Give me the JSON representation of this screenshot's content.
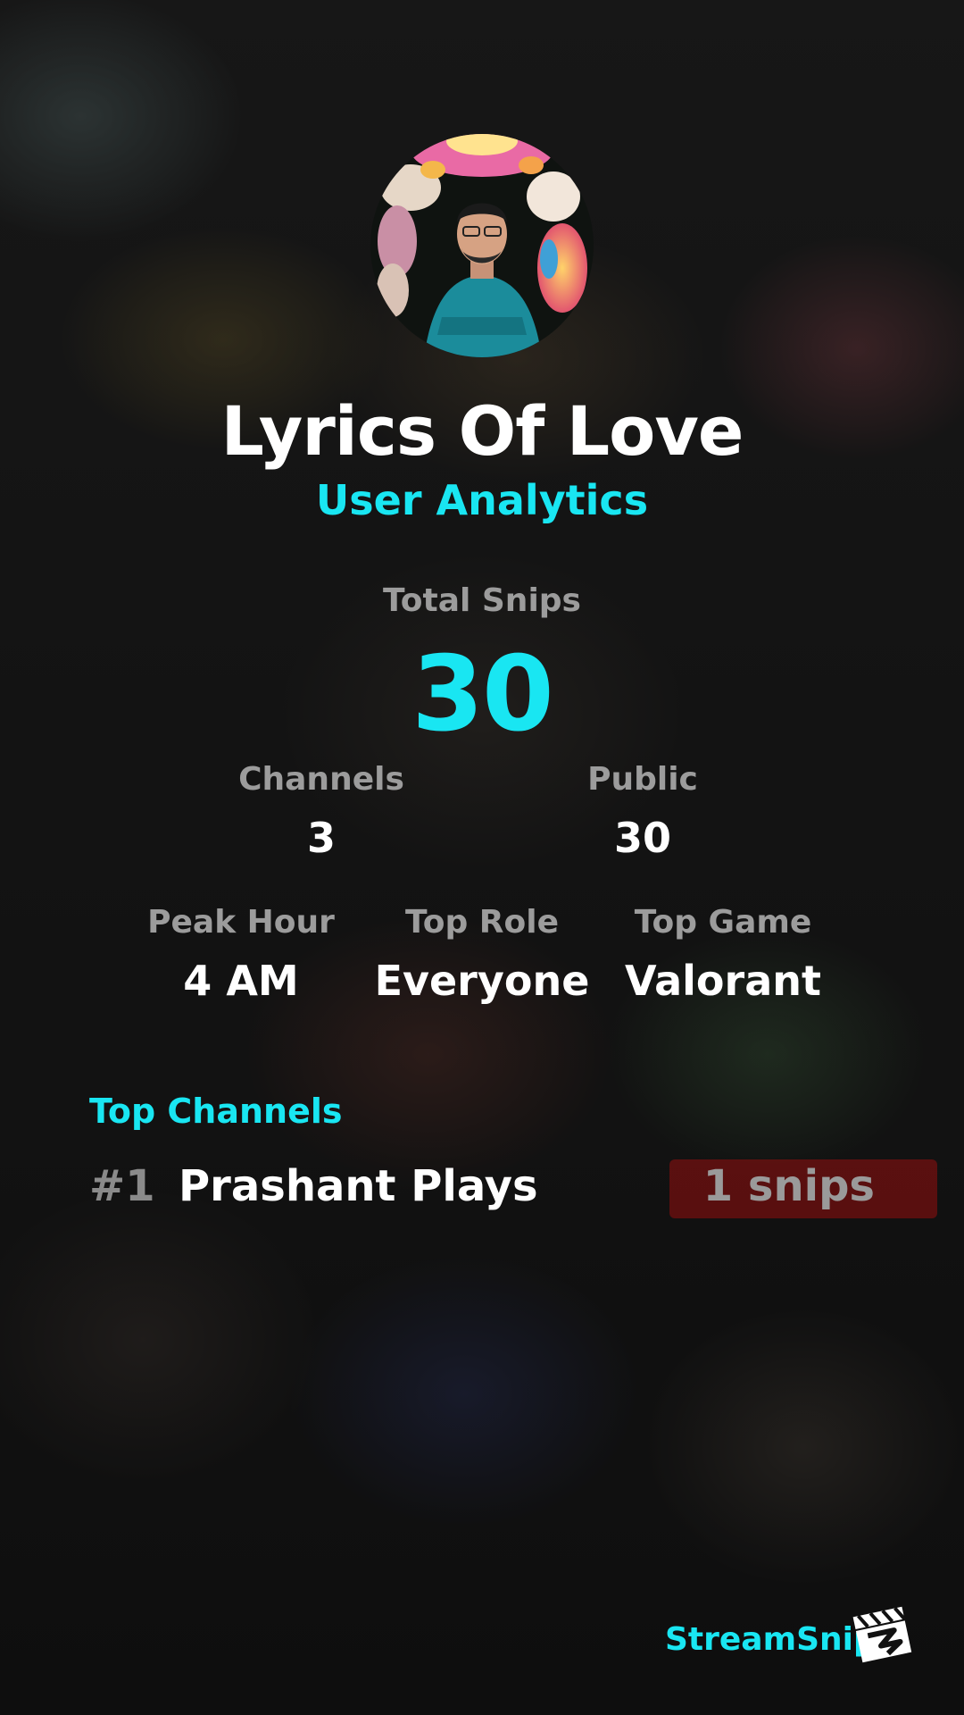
{
  "profile": {
    "name": "Lyrics Of Love",
    "subtitle": "User Analytics"
  },
  "stats": {
    "total_snips": {
      "label": "Total Snips",
      "value": "30"
    },
    "channels": {
      "label": "Channels",
      "value": "3"
    },
    "public": {
      "label": "Public",
      "value": "30"
    },
    "peak_hour": {
      "label": "Peak Hour",
      "value": "4 AM"
    },
    "top_role": {
      "label": "Top Role",
      "value": "Everyone"
    },
    "top_game": {
      "label": "Top Game",
      "value": "Valorant"
    }
  },
  "top_channels": {
    "heading": "Top Channels",
    "items": [
      {
        "rank": "#1",
        "name": "Prashant Plays",
        "snips": "1 snips"
      }
    ]
  },
  "brand": {
    "name": "StreamSnip",
    "logo_icon": "clapperboard-icon"
  },
  "colors": {
    "accent": "#19e6f2",
    "muted": "#9c9c9c",
    "text": "#ffffff",
    "highlight": "#960f0f"
  }
}
